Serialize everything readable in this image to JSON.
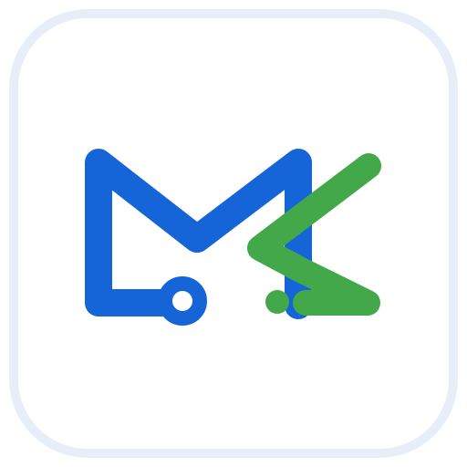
{
  "icon": {
    "name": "app-icon",
    "logo_name": "mk-logo-icon",
    "colors": {
      "background": "#ffffff",
      "border": "#e8eef8",
      "primary_blue": "#1565d8",
      "accent_green": "#43a84a"
    }
  }
}
